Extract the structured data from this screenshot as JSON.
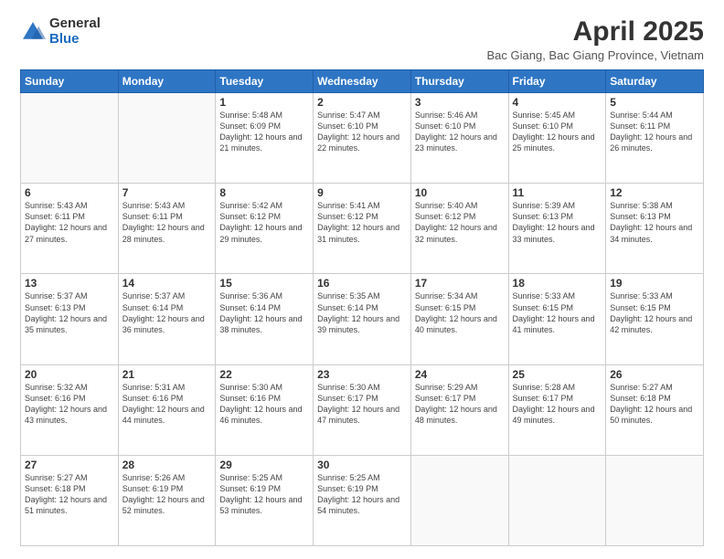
{
  "logo": {
    "general": "General",
    "blue": "Blue"
  },
  "header": {
    "title": "April 2025",
    "subtitle": "Bac Giang, Bac Giang Province, Vietnam"
  },
  "weekdays": [
    "Sunday",
    "Monday",
    "Tuesday",
    "Wednesday",
    "Thursday",
    "Friday",
    "Saturday"
  ],
  "days": [
    {
      "num": "",
      "info": ""
    },
    {
      "num": "",
      "info": ""
    },
    {
      "num": "1",
      "info": "Sunrise: 5:48 AM\nSunset: 6:09 PM\nDaylight: 12 hours and 21 minutes."
    },
    {
      "num": "2",
      "info": "Sunrise: 5:47 AM\nSunset: 6:10 PM\nDaylight: 12 hours and 22 minutes."
    },
    {
      "num": "3",
      "info": "Sunrise: 5:46 AM\nSunset: 6:10 PM\nDaylight: 12 hours and 23 minutes."
    },
    {
      "num": "4",
      "info": "Sunrise: 5:45 AM\nSunset: 6:10 PM\nDaylight: 12 hours and 25 minutes."
    },
    {
      "num": "5",
      "info": "Sunrise: 5:44 AM\nSunset: 6:11 PM\nDaylight: 12 hours and 26 minutes."
    },
    {
      "num": "6",
      "info": "Sunrise: 5:43 AM\nSunset: 6:11 PM\nDaylight: 12 hours and 27 minutes."
    },
    {
      "num": "7",
      "info": "Sunrise: 5:43 AM\nSunset: 6:11 PM\nDaylight: 12 hours and 28 minutes."
    },
    {
      "num": "8",
      "info": "Sunrise: 5:42 AM\nSunset: 6:12 PM\nDaylight: 12 hours and 29 minutes."
    },
    {
      "num": "9",
      "info": "Sunrise: 5:41 AM\nSunset: 6:12 PM\nDaylight: 12 hours and 31 minutes."
    },
    {
      "num": "10",
      "info": "Sunrise: 5:40 AM\nSunset: 6:12 PM\nDaylight: 12 hours and 32 minutes."
    },
    {
      "num": "11",
      "info": "Sunrise: 5:39 AM\nSunset: 6:13 PM\nDaylight: 12 hours and 33 minutes."
    },
    {
      "num": "12",
      "info": "Sunrise: 5:38 AM\nSunset: 6:13 PM\nDaylight: 12 hours and 34 minutes."
    },
    {
      "num": "13",
      "info": "Sunrise: 5:37 AM\nSunset: 6:13 PM\nDaylight: 12 hours and 35 minutes."
    },
    {
      "num": "14",
      "info": "Sunrise: 5:37 AM\nSunset: 6:14 PM\nDaylight: 12 hours and 36 minutes."
    },
    {
      "num": "15",
      "info": "Sunrise: 5:36 AM\nSunset: 6:14 PM\nDaylight: 12 hours and 38 minutes."
    },
    {
      "num": "16",
      "info": "Sunrise: 5:35 AM\nSunset: 6:14 PM\nDaylight: 12 hours and 39 minutes."
    },
    {
      "num": "17",
      "info": "Sunrise: 5:34 AM\nSunset: 6:15 PM\nDaylight: 12 hours and 40 minutes."
    },
    {
      "num": "18",
      "info": "Sunrise: 5:33 AM\nSunset: 6:15 PM\nDaylight: 12 hours and 41 minutes."
    },
    {
      "num": "19",
      "info": "Sunrise: 5:33 AM\nSunset: 6:15 PM\nDaylight: 12 hours and 42 minutes."
    },
    {
      "num": "20",
      "info": "Sunrise: 5:32 AM\nSunset: 6:16 PM\nDaylight: 12 hours and 43 minutes."
    },
    {
      "num": "21",
      "info": "Sunrise: 5:31 AM\nSunset: 6:16 PM\nDaylight: 12 hours and 44 minutes."
    },
    {
      "num": "22",
      "info": "Sunrise: 5:30 AM\nSunset: 6:16 PM\nDaylight: 12 hours and 46 minutes."
    },
    {
      "num": "23",
      "info": "Sunrise: 5:30 AM\nSunset: 6:17 PM\nDaylight: 12 hours and 47 minutes."
    },
    {
      "num": "24",
      "info": "Sunrise: 5:29 AM\nSunset: 6:17 PM\nDaylight: 12 hours and 48 minutes."
    },
    {
      "num": "25",
      "info": "Sunrise: 5:28 AM\nSunset: 6:17 PM\nDaylight: 12 hours and 49 minutes."
    },
    {
      "num": "26",
      "info": "Sunrise: 5:27 AM\nSunset: 6:18 PM\nDaylight: 12 hours and 50 minutes."
    },
    {
      "num": "27",
      "info": "Sunrise: 5:27 AM\nSunset: 6:18 PM\nDaylight: 12 hours and 51 minutes."
    },
    {
      "num": "28",
      "info": "Sunrise: 5:26 AM\nSunset: 6:19 PM\nDaylight: 12 hours and 52 minutes."
    },
    {
      "num": "29",
      "info": "Sunrise: 5:25 AM\nSunset: 6:19 PM\nDaylight: 12 hours and 53 minutes."
    },
    {
      "num": "30",
      "info": "Sunrise: 5:25 AM\nSunset: 6:19 PM\nDaylight: 12 hours and 54 minutes."
    },
    {
      "num": "",
      "info": ""
    },
    {
      "num": "",
      "info": ""
    },
    {
      "num": "",
      "info": ""
    }
  ]
}
